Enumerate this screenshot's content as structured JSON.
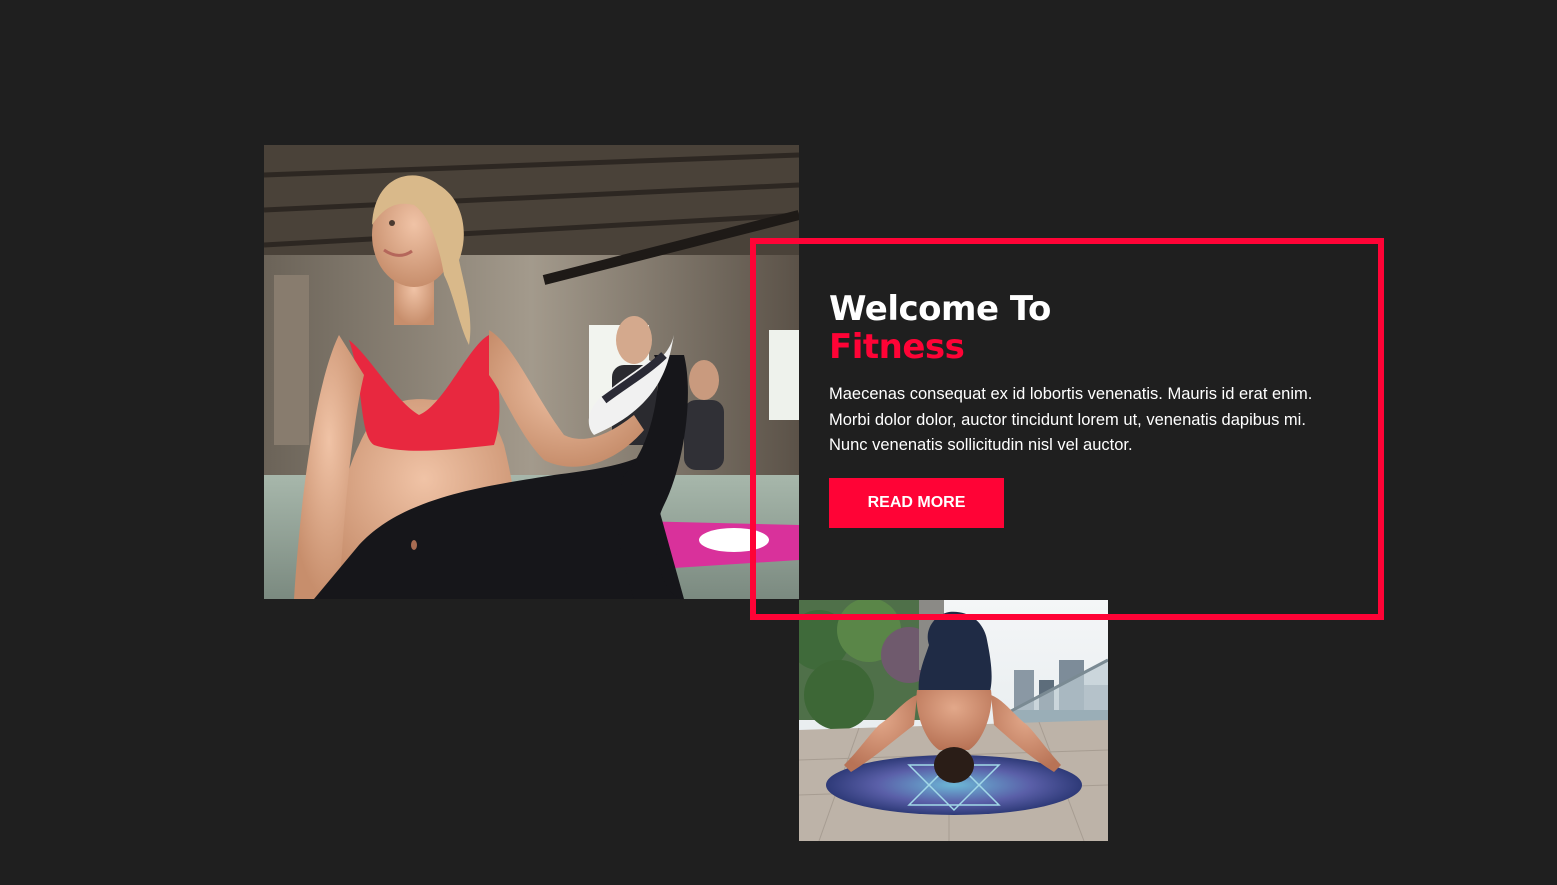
{
  "hero": {
    "title_line1": "Welcome To",
    "title_line2": "Fitness",
    "description": "Maecenas consequat ex id lobortis venenatis. Mauris id erat enim. Morbi dolor dolor, auctor tincidunt lorem ut, venenatis dapibus mi. Nunc venenatis sollicitudin nisl vel auctor.",
    "button_label": "READ MORE"
  },
  "colors": {
    "background": "#1f1f1f",
    "accent": "#ff0336",
    "text": "#ffffff"
  }
}
